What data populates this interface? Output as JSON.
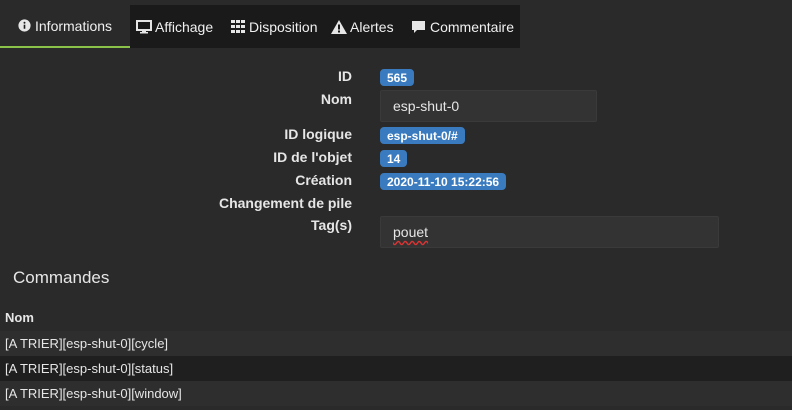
{
  "tabs": [
    {
      "label": "Informations",
      "icon": "info-circle-icon",
      "active": true
    },
    {
      "label": "Affichage",
      "icon": "monitor-icon"
    },
    {
      "label": "Disposition",
      "icon": "grid-icon"
    },
    {
      "label": "Alertes",
      "icon": "warning-icon"
    },
    {
      "label": "Commentaire",
      "icon": "comment-icon"
    }
  ],
  "info": {
    "id_label": "ID",
    "id_value": "565",
    "name_label": "Nom",
    "name_value": "esp-shut-0",
    "logical_id_label": "ID logique",
    "logical_id_value": "esp-shut-0/#",
    "object_id_label": "ID de l'objet",
    "object_id_value": "14",
    "creation_label": "Création",
    "creation_value": "2020-11-10 15:22:56",
    "battery_change_label": "Changement de pile",
    "tags_label": "Tag(s)",
    "tags_value": "pouet"
  },
  "commands": {
    "title": "Commandes",
    "column_header": "Nom",
    "rows": [
      "[A TRIER][esp-shut-0][cycle]",
      "[A TRIER][esp-shut-0][status]",
      "[A TRIER][esp-shut-0][window]"
    ]
  },
  "colors": {
    "badge": "#3a7bbf",
    "active_tab_border": "#8bc34a",
    "background": "#2a2a2a"
  }
}
